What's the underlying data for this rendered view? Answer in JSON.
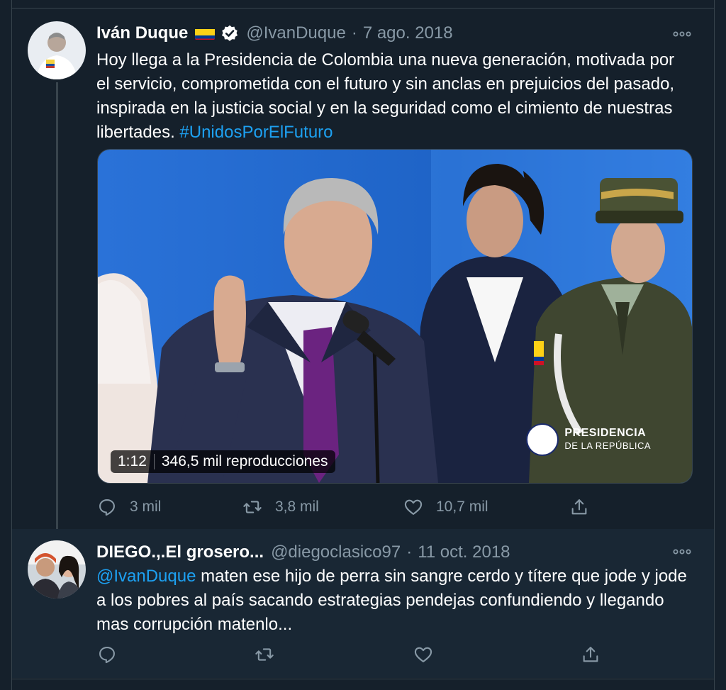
{
  "tweets": [
    {
      "name": "Iván Duque",
      "handle": "@IvanDuque",
      "separator": "·",
      "time": "7 ago. 2018",
      "text": "Hoy llega a la Presidencia de Colombia una nueva generación, motivada por el servicio, comprometida con el futuro y sin anclas en prejuicios del pasado, inspirada en la justicia social y en la seguridad como el cimiento de nuestras libertades.",
      "hashtag": "#UnidosPorElFuturo",
      "video": {
        "duration": "1:12",
        "views": "346,5 mil reproducciones",
        "watermark_title": "PRESIDENCIA",
        "watermark_sub": "DE LA REPÚBLICA"
      },
      "replies": "3 mil",
      "retweets": "3,8 mil",
      "likes": "10,7 mil"
    },
    {
      "name": "DIEGO.,.El grosero...",
      "handle": "@diegoclasico97",
      "separator": "·",
      "time": "11 oct. 2018",
      "mention": "@IvanDuque",
      "text": " maten ese hijo de perra sin sangre cerdo y títere que jode y jode a los pobres al país sacando estrategias pendejas confundiendo y llegando mas corrupción matenlo..."
    }
  ],
  "icons": {
    "reply": "reply-icon",
    "retweet": "retweet-icon",
    "like": "like-icon",
    "share": "share-icon",
    "more": "more-icon",
    "verified": "verified-badge-icon",
    "flag": "colombia-flag-icon"
  },
  "colors": {
    "background": "#15202b",
    "reply_background": "#192734",
    "link": "#1da1f2",
    "secondary_text": "#8899a6"
  }
}
